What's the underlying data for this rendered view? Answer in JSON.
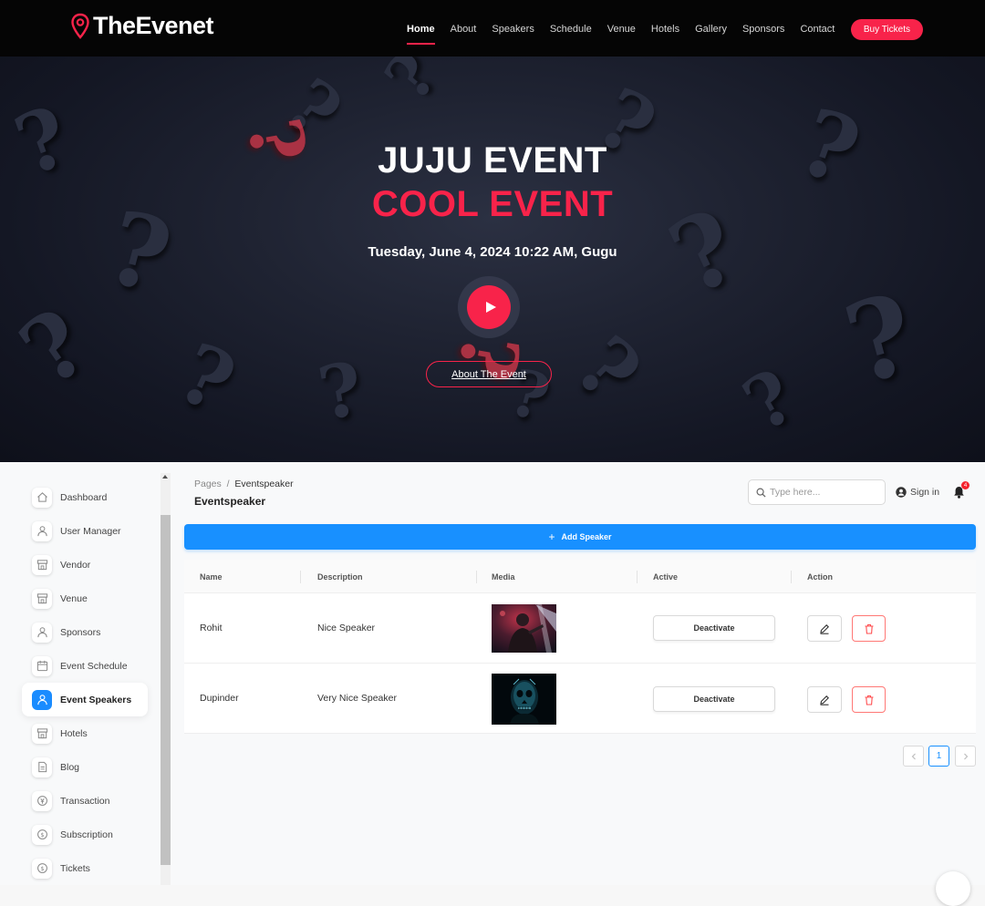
{
  "header": {
    "logo_text": "TheEvenet",
    "nav": [
      {
        "label": "Home",
        "active": true
      },
      {
        "label": "About",
        "active": false
      },
      {
        "label": "Speakers",
        "active": false
      },
      {
        "label": "Schedule",
        "active": false
      },
      {
        "label": "Venue",
        "active": false
      },
      {
        "label": "Hotels",
        "active": false
      },
      {
        "label": "Gallery",
        "active": false
      },
      {
        "label": "Sponsors",
        "active": false
      },
      {
        "label": "Contact",
        "active": false
      }
    ],
    "buy_tickets_label": "Buy Tickets",
    "accent_color": "#f8234a"
  },
  "hero": {
    "title_line1": "JUJU EVENT",
    "title_line2": "COOL EVENT",
    "date_location": "Tuesday, June 4, 2024 10:22 AM, Gugu",
    "play_icon": "play-icon",
    "about_button_label": "About The Event"
  },
  "sidebar": {
    "items": [
      {
        "label": "Dashboard",
        "icon": "home-icon",
        "active": false
      },
      {
        "label": "User Manager",
        "icon": "user-icon",
        "active": false
      },
      {
        "label": "Vendor",
        "icon": "shop-icon",
        "active": false
      },
      {
        "label": "Venue",
        "icon": "shop-icon",
        "active": false
      },
      {
        "label": "Sponsors",
        "icon": "user-icon",
        "active": false
      },
      {
        "label": "Event Schedule",
        "icon": "calendar-icon",
        "active": false
      },
      {
        "label": "Event Speakers",
        "icon": "user-icon",
        "active": true
      },
      {
        "label": "Hotels",
        "icon": "shop-icon",
        "active": false
      },
      {
        "label": "Blog",
        "icon": "file-icon",
        "active": false
      },
      {
        "label": "Transaction",
        "icon": "transaction-icon",
        "active": false
      },
      {
        "label": "Subscription",
        "icon": "dollar-icon",
        "active": false
      },
      {
        "label": "Tickets",
        "icon": "dollar-icon",
        "active": false
      }
    ]
  },
  "breadcrumb": {
    "root": "Pages",
    "separator": "/",
    "current": "Eventspeaker"
  },
  "page_title": "Eventspeaker",
  "search": {
    "placeholder": "Type here...",
    "value": ""
  },
  "sign_in_label": "Sign in",
  "notifications": {
    "count": "4"
  },
  "add_button_label": "Add Speaker",
  "table": {
    "columns": [
      "Name",
      "Description",
      "Media",
      "Active",
      "Action"
    ],
    "rows": [
      {
        "name": "Rohit",
        "description": "Nice Speaker",
        "active_button": "Deactivate",
        "media": "speaker-photo"
      },
      {
        "name": "Dupinder",
        "description": "Very Nice Speaker",
        "active_button": "Deactivate",
        "media": "skull-mask-photo"
      }
    ]
  },
  "pagination": {
    "current_page": "1",
    "prev_icon": "chevron-left-icon",
    "next_icon": "chevron-right-icon"
  },
  "colors": {
    "primary_blue": "#1890ff",
    "danger_red": "#ff4d4f",
    "header_bg": "#050505"
  }
}
